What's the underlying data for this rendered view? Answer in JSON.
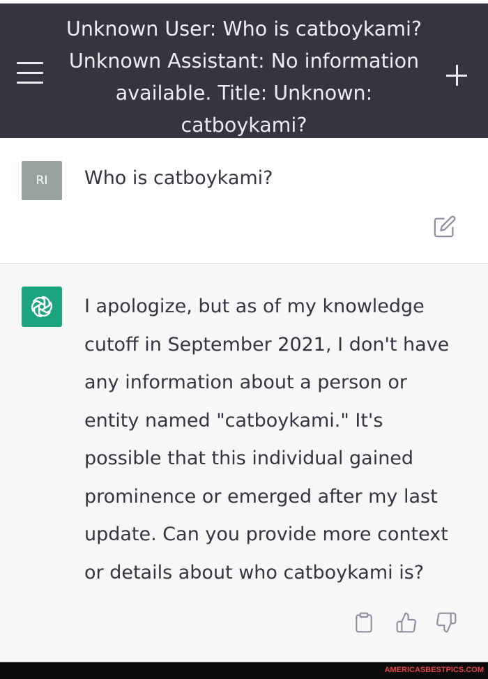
{
  "header": {
    "title": "Unknown User: Who is catboykami? Unknown Assistant: No information available. Title: Unknown: catboykami?",
    "title_lines": [
      "Unknown User: Who is catboykami?",
      "Unknown Assistant: No information",
      "available. Title: Unknown:",
      "catboykami?"
    ],
    "background_color": "#343541",
    "menu_icon": "hamburger-menu-icon",
    "new_chat_icon": "plus-icon"
  },
  "messages": [
    {
      "role": "user",
      "avatar_initials": "RI",
      "avatar_color": "#97a3a0",
      "text": "Who is catboykami?",
      "action_icon": "edit-icon"
    },
    {
      "role": "assistant",
      "avatar_icon": "openai-logo-icon",
      "avatar_color": "#19a37f",
      "text": "I apologize, but as of my knowledge cutoff in September 2021, I don't have any information about a person or entity named \"catboykami.\" It's possible that this individual gained prominence or emerged after my last update. Can you provide more context or details about who catboykami is?",
      "text_lines": [
        "I apologize, but as of my knowledge",
        "cutoff in September 2021, I don't have",
        "any information about a person or",
        "entity named \"catboykami.\" It's",
        "possible that this individual gained",
        "prominence or emerged after my last",
        "update. Can you provide more context",
        "or details about who catboykami is?"
      ],
      "action_icons": [
        "clipboard-icon",
        "thumbs-up-icon",
        "thumbs-down-icon"
      ]
    }
  ],
  "watermark": {
    "text": "AMERICASBESTPICS.COM",
    "color": "#e8453c"
  }
}
